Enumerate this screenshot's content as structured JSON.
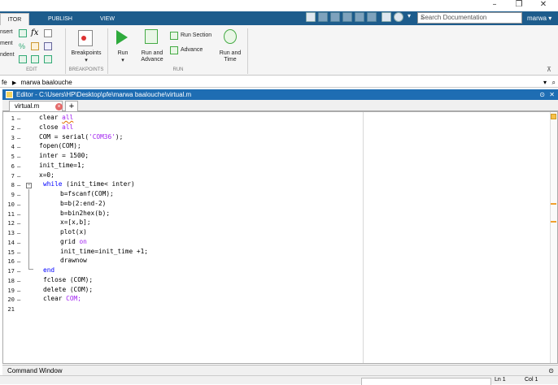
{
  "window": {
    "minimize": "–",
    "restore": "❐",
    "close": "✕"
  },
  "tabs": [
    {
      "label": "ITOR"
    },
    {
      "label": "PUBLISH"
    },
    {
      "label": "VIEW"
    }
  ],
  "search": {
    "placeholder": "Search Documentation"
  },
  "user": {
    "name": "marwa ▾"
  },
  "ribbon": {
    "edit_items": [
      "nsert",
      "ment",
      "ndent"
    ],
    "fx_label": "fx",
    "breakpoints_label": "Breakpoints",
    "run_label": "Run",
    "run_and_advance_label": "Run and\nAdvance",
    "run_section_label": "Run Section",
    "advance_label": "Advance",
    "run_and_time_label": "Run and\nTime",
    "sections": {
      "edit": "EDIT",
      "breakpoints": "BREAKPOINTS",
      "run": "RUN"
    }
  },
  "address": {
    "prefix": "fe",
    "arrow": "▶",
    "folder": "marwa baalouche"
  },
  "editor": {
    "title": "Editor - C:\\Users\\HP\\Desktop\\pfe\\marwa baalouche\\virtual.m",
    "file_tab": "virtual.m",
    "plus": "+",
    "lines": [
      {
        "n": "1",
        "dash": "–"
      },
      {
        "n": "2",
        "dash": "–"
      },
      {
        "n": "3",
        "dash": "–"
      },
      {
        "n": "4",
        "dash": "–"
      },
      {
        "n": "5",
        "dash": "–"
      },
      {
        "n": "6",
        "dash": "–"
      },
      {
        "n": "7",
        "dash": "–"
      },
      {
        "n": "8",
        "dash": "–"
      },
      {
        "n": "9",
        "dash": "–"
      },
      {
        "n": "10",
        "dash": "–"
      },
      {
        "n": "11",
        "dash": "–"
      },
      {
        "n": "12",
        "dash": "–"
      },
      {
        "n": "13",
        "dash": "–"
      },
      {
        "n": "14",
        "dash": "–"
      },
      {
        "n": "15",
        "dash": "–"
      },
      {
        "n": "16",
        "dash": "–"
      },
      {
        "n": "17",
        "dash": "–"
      },
      {
        "n": "18",
        "dash": "–"
      },
      {
        "n": "19",
        "dash": "–"
      },
      {
        "n": "20",
        "dash": "–"
      },
      {
        "n": "21",
        "dash": ""
      }
    ],
    "code": {
      "l1a": "clear ",
      "l1b": "all",
      "l2a": "close ",
      "l2b": "all",
      "l3a": "COM = serial(",
      "l3b": "'COM36'",
      "l3c": ");",
      "l4": "fopen(COM);",
      "l5": "inter = 1500;",
      "l6": "init_time=1;",
      "l7": "x=0;",
      "l8a": "while",
      "l8b": " (init_time< inter)",
      "l9": "b=fscanf(COM);",
      "l10": "b=b(2:end-2)",
      "l11": "b=bin2hex(b);",
      "l12": "x=[x,b];",
      "l13": "plot(x)",
      "l14a": "grid ",
      "l14b": "on",
      "l15": "init_time=init_time +1;",
      "l16": "drawnow",
      "l17": "end",
      "l18": "fclose (COM);",
      "l19": "delete (COM);",
      "l20a": "clear ",
      "l20b": "COM;"
    }
  },
  "command_window": {
    "label": "Command Window"
  },
  "status": {
    "ln": "Ln  1",
    "col": "Col  1"
  },
  "colors": {
    "tabbar": "#1d5c8c",
    "editor_title": "#1e6db3",
    "keyword": "#0000ff",
    "string": "#a020f0"
  }
}
